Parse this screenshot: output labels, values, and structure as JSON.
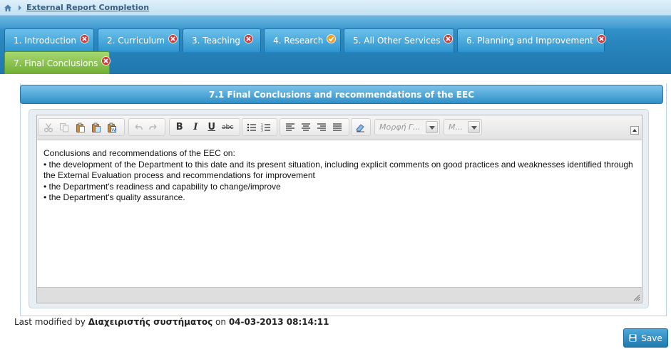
{
  "breadcrumb": {
    "home_icon": "home-icon",
    "link_label": "External Report Completion"
  },
  "tabs": [
    {
      "label": "1. Introduction",
      "status": "incomplete",
      "status_icon": "error-icon"
    },
    {
      "label": "2. Curriculum",
      "status": "incomplete",
      "status_icon": "error-icon"
    },
    {
      "label": "3. Teaching",
      "status": "incomplete",
      "status_icon": "error-icon"
    },
    {
      "label": "4. Research",
      "status": "complete",
      "status_icon": "check-icon"
    },
    {
      "label": "5. All Other Services",
      "status": "incomplete",
      "status_icon": "error-icon"
    },
    {
      "label": "6. Planning and Improvement",
      "status": "incomplete",
      "status_icon": "error-icon"
    },
    {
      "label": "7. Final Conclusions",
      "status": "incomplete",
      "status_icon": "error-icon",
      "active": true
    }
  ],
  "section": {
    "title": "7.1 Final Conclusions and recommendations of the EEC"
  },
  "editor": {
    "toolbar": {
      "format_combo": "Μορφή Γ...",
      "size_combo": "Μ..."
    },
    "content": [
      "Conclusions and recommendations of the EEC on:",
      "• the development of the Department to this date and its present situation, including explicit comments on good practices and weaknesses identified through the External Evaluation process and recommendations for improvement",
      "• the Department's readiness and capability to change/improve",
      "• the Department's quality assurance."
    ]
  },
  "footer": {
    "last_modified_prefix": "Last modified by",
    "last_modified_user": "Διαχειριστής συστήματος",
    "last_modified_on": "on",
    "last_modified_date": "04-03-2013 08:14:11",
    "save_label": "Save"
  },
  "colors": {
    "tab_blue": "#2d94cf",
    "tab_active_green": "#6fae35",
    "error_red": "#d33b3b",
    "check_orange": "#f0a020",
    "header_blue": "#2f90c8"
  }
}
